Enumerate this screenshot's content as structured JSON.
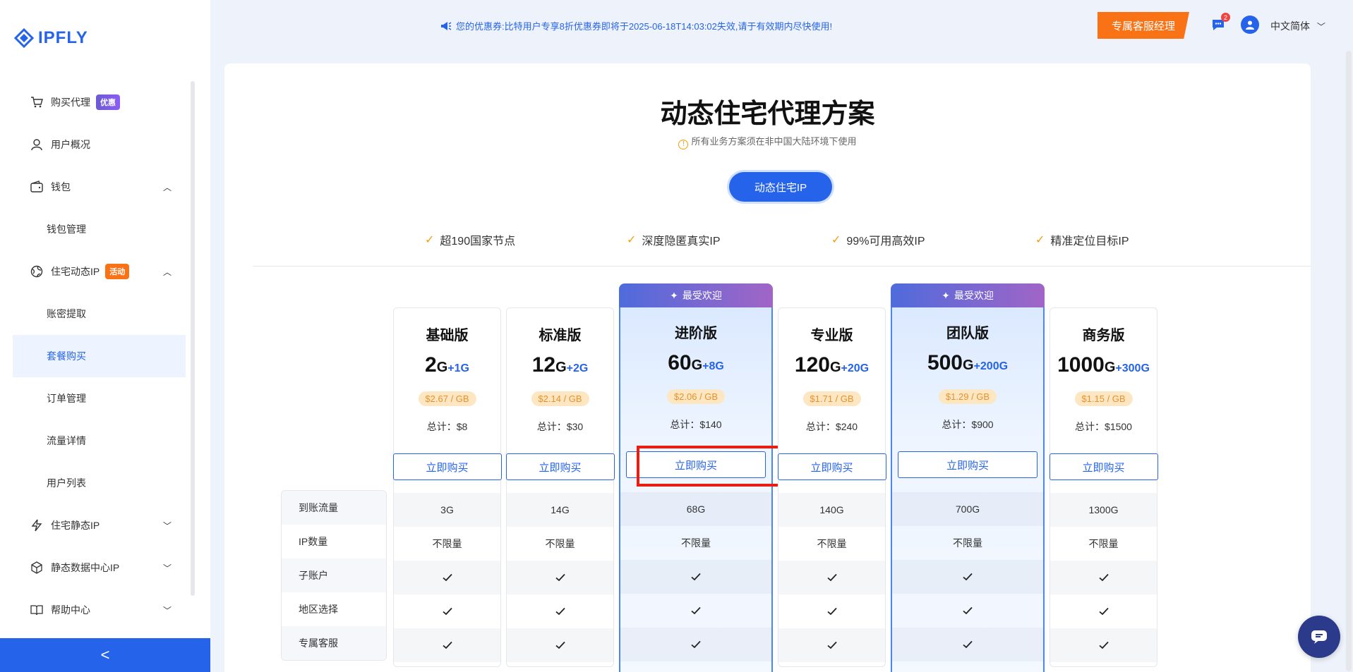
{
  "brand": {
    "name": "IPFLY",
    "color": "#2563eb"
  },
  "sidebar": {
    "items": [
      {
        "label": "购买代理",
        "icon": "cart-icon",
        "badge": "优惠",
        "badge_color": "purple"
      },
      {
        "label": "用户概况",
        "icon": "user-icon"
      },
      {
        "label": "钱包",
        "icon": "wallet-icon",
        "caret": "up"
      },
      {
        "label": "钱包管理",
        "sub": true
      },
      {
        "label": "住宅动态IP",
        "icon": "globe-icon",
        "badge": "活动",
        "badge_color": "orange",
        "caret": "up"
      },
      {
        "label": "账密提取",
        "sub": true
      },
      {
        "label": "套餐购买",
        "sub": true,
        "active": true
      },
      {
        "label": "订单管理",
        "sub": true
      },
      {
        "label": "流量详情",
        "sub": true
      },
      {
        "label": "用户列表",
        "sub": true
      },
      {
        "label": "住宅静态IP",
        "icon": "bolt-icon",
        "caret": "down"
      },
      {
        "label": "静态数据中心IP",
        "icon": "cube-icon",
        "caret": "down"
      },
      {
        "label": "帮助中心",
        "icon": "book-icon",
        "caret": "down"
      }
    ],
    "collapse_label": "<"
  },
  "topbar": {
    "notice": "您的优惠券:比特用户专享8折优惠券即将于2025-06-18T14:03:02失效,请于有效期内尽快使用!",
    "manager_button": "专属客服经理",
    "message_count": "2",
    "language": "中文简体"
  },
  "page": {
    "title": "动态住宅代理方案",
    "note": "所有业务方案须在非中国大陆环境下使用",
    "tab": "动态住宅IP",
    "features": [
      "超190国家节点",
      "深度隐匿真实IP",
      "99%可用高效IP",
      "精准定位目标IP"
    ]
  },
  "table": {
    "row_labels": [
      "到账流量",
      "IP数量",
      "子账户",
      "地区选择",
      "专属客服"
    ]
  },
  "plans": [
    {
      "name": "基础版",
      "base": "2",
      "unit": "G",
      "bonus": "+1G",
      "price": "$2.67 / GB",
      "total": "总计：$8",
      "buy": "立即购买",
      "rows": [
        "3G",
        "不限量",
        "check",
        "check",
        "check"
      ]
    },
    {
      "name": "标准版",
      "base": "12",
      "unit": "G",
      "bonus": "+2G",
      "price": "$2.14 / GB",
      "total": "总计：$30",
      "buy": "立即购买",
      "rows": [
        "14G",
        "不限量",
        "check",
        "check",
        "check"
      ]
    },
    {
      "name": "进阶版",
      "base": "60",
      "unit": "G",
      "bonus": "+8G",
      "price": "$2.06 / GB",
      "total": "总计：$140",
      "buy": "立即购买",
      "hot": "最受欢迎",
      "rows": [
        "68G",
        "不限量",
        "check",
        "check",
        "check"
      ]
    },
    {
      "name": "专业版",
      "base": "120",
      "unit": "G",
      "bonus": "+20G",
      "price": "$1.71 / GB",
      "total": "总计：$240",
      "buy": "立即购买",
      "rows": [
        "140G",
        "不限量",
        "check",
        "check",
        "check"
      ]
    },
    {
      "name": "团队版",
      "base": "500",
      "unit": "G",
      "bonus": "+200G",
      "price": "$1.29 / GB",
      "total": "总计：$900",
      "buy": "立即购买",
      "hot": "最受欢迎",
      "rows": [
        "700G",
        "不限量",
        "check",
        "check",
        "check"
      ]
    },
    {
      "name": "商务版",
      "base": "1000",
      "unit": "G",
      "bonus": "+300G",
      "price": "$1.15 / GB",
      "total": "总计：$1500",
      "buy": "立即购买",
      "rows": [
        "1300G",
        "不限量",
        "check",
        "check",
        "check"
      ]
    }
  ],
  "colors": {
    "accent": "#2563eb",
    "orange": "#f97316",
    "highlight": "#e81e10",
    "price_bg": "#fde7c2"
  }
}
